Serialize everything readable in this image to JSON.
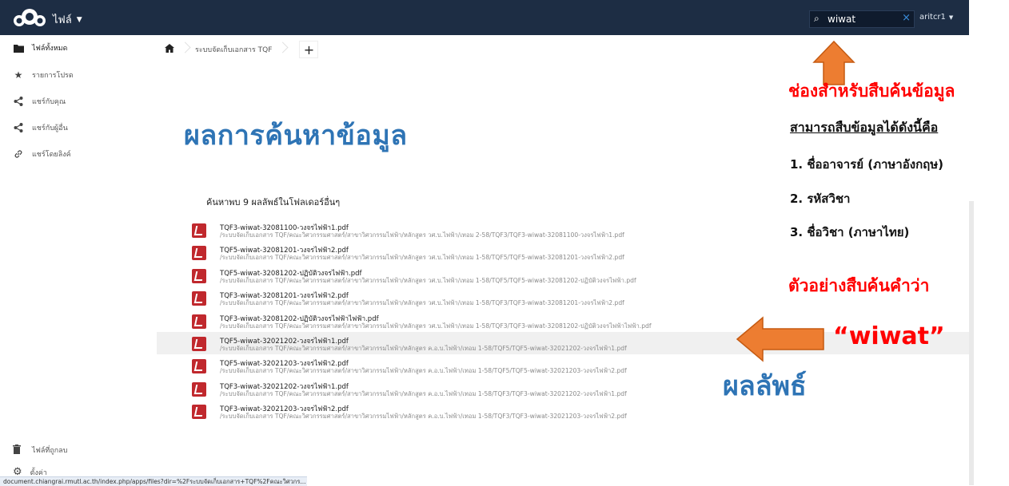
{
  "header": {
    "app_name": "ไฟล์",
    "search_value": "wiwat",
    "user": "aritcr1"
  },
  "sidebar": {
    "items": [
      {
        "label": "ไฟล์ทั้งหมด",
        "icon": "folder-icon"
      },
      {
        "label": "รายการโปรด",
        "icon": "star-icon"
      },
      {
        "label": "แชร์กับคุณ",
        "icon": "share-icon"
      },
      {
        "label": "แชร์กับผู้อื่น",
        "icon": "share-icon"
      },
      {
        "label": "แชร์โดยลิงค์",
        "icon": "link-icon"
      }
    ],
    "trash_label": "ไฟล์ที่ถูกลบ",
    "settings_label": "ตั้งค่า"
  },
  "breadcrumb": {
    "folder": "ระบบจัดเก็บเอกสาร TQF"
  },
  "main": {
    "headline": "ผลการค้นหาข้อมูล",
    "summary": "ค้นหาพบ 9 ผลลัพธ์ในโฟลเดอร์อื่นๆ",
    "results": [
      {
        "name": "TQF3-wiwat-32081100-วงจรไฟฟ้า1.pdf",
        "path": "/ระบบจัดเก็บเอกสาร TQF/คณะวิศวกรรมศาสตร์/สาขาวิศวกรรมไฟฟ้า/หลักสูตร วศ.บ.ไฟฟ้า/เทอม 2-58/TQF3/TQF3-wiwat-32081100-วงจรไฟฟ้า1.pdf"
      },
      {
        "name": "TQF5-wiwat-32081201-วงจรไฟฟ้า2.pdf",
        "path": "/ระบบจัดเก็บเอกสาร TQF/คณะวิศวกรรมศาสตร์/สาขาวิศวกรรมไฟฟ้า/หลักสูตร วศ.บ.ไฟฟ้า/เทอม 1-58/TQF5/TQF5-wiwat-32081201-วงจรไฟฟ้า2.pdf"
      },
      {
        "name": "TQF5-wiwat-32081202-ปฏิบัติวงจรไฟฟ้า.pdf",
        "path": "/ระบบจัดเก็บเอกสาร TQF/คณะวิศวกรรมศาสตร์/สาขาวิศวกรรมไฟฟ้า/หลักสูตร วศ.บ.ไฟฟ้า/เทอม 1-58/TQF5/TQF5-wiwat-32081202-ปฏิบัติวงจรไฟฟ้า.pdf"
      },
      {
        "name": "TQF3-wiwat-32081201-วงจรไฟฟ้า2.pdf",
        "path": "/ระบบจัดเก็บเอกสาร TQF/คณะวิศวกรรมศาสตร์/สาขาวิศวกรรมไฟฟ้า/หลักสูตร วศ.บ.ไฟฟ้า/เทอม 1-58/TQF3/TQF3-wiwat-32081201-วงจรไฟฟ้า2.pdf"
      },
      {
        "name": "TQF3-wiwat-32081202-ปฏิบัติวงจรไฟฟ้าไฟฟ้า.pdf",
        "path": "/ระบบจัดเก็บเอกสาร TQF/คณะวิศวกรรมศาสตร์/สาขาวิศวกรรมไฟฟ้า/หลักสูตร วศ.บ.ไฟฟ้า/เทอม 1-58/TQF3/TQF3-wiwat-32081202-ปฏิบัติวงจรไฟฟ้าไฟฟ้า.pdf"
      },
      {
        "name": "TQF5-wiwat-32021202-วงจรไฟฟ้า1.pdf",
        "path": "/ระบบจัดเก็บเอกสาร TQF/คณะวิศวกรรมศาสตร์/สาขาวิศวกรรมไฟฟ้า/หลักสูตร ค.อ.บ.ไฟฟ้า/เทอม 1-58/TQF5/TQF5-wiwat-32021202-วงจรไฟฟ้า1.pdf"
      },
      {
        "name": "TQF5-wiwat-32021203-วงจรไฟฟ้า2.pdf",
        "path": "/ระบบจัดเก็บเอกสาร TQF/คณะวิศวกรรมศาสตร์/สาขาวิศวกรรมไฟฟ้า/หลักสูตร ค.อ.บ.ไฟฟ้า/เทอม 1-58/TQF5/TQF5-wiwat-32021203-วงจรไฟฟ้า2.pdf"
      },
      {
        "name": "TQF3-wiwat-32021202-วงจรไฟฟ้า1.pdf",
        "path": "/ระบบจัดเก็บเอกสาร TQF/คณะวิศวกรรมศาสตร์/สาขาวิศวกรรมไฟฟ้า/หลักสูตร ค.อ.บ.ไฟฟ้า/เทอม 1-58/TQF3/TQF3-wiwat-32021202-วงจรไฟฟ้า1.pdf"
      },
      {
        "name": "TQF3-wiwat-32021203-วงจรไฟฟ้า2.pdf",
        "path": "/ระบบจัดเก็บเอกสาร TQF/คณะวิศวกรรมศาสตร์/สาขาวิศวกรรมไฟฟ้า/หลักสูตร ค.อ.บ.ไฟฟ้า/เทอม 1-58/TQF3/TQF3-wiwat-32021203-วงจรไฟฟ้า2.pdf"
      }
    ]
  },
  "status_url": "document.chiangrai.rmutl.ac.th/index.php/apps/files?dir=%2Fระบบจัดเก็บเอกสาร+TQF%2Fคณะวิศวกร...",
  "annotations": {
    "search_hint": "ช่องสำหรับสืบค้นข้อมูล",
    "search_can": "สามารถสืบข้อมูลได้ดังนี้คือ",
    "item1": "1. ชื่ออาจารย์ (ภาษาอังกฤษ)",
    "item2": "2. รหัสวิชา",
    "item3": "3. ชื่อวิชา (ภาษาไทย)",
    "example": "ตัวอย่างสืบค้นคำว่า",
    "example_word": "“wiwat”",
    "result_label": "ผลลัพธ์"
  },
  "colors": {
    "topbar": "#1d2d44",
    "annotation_red": "#ff0000",
    "annotation_blue": "#2e74b5",
    "arrow_orange": "#ed7d31",
    "pdf_red": "#c0282d"
  }
}
